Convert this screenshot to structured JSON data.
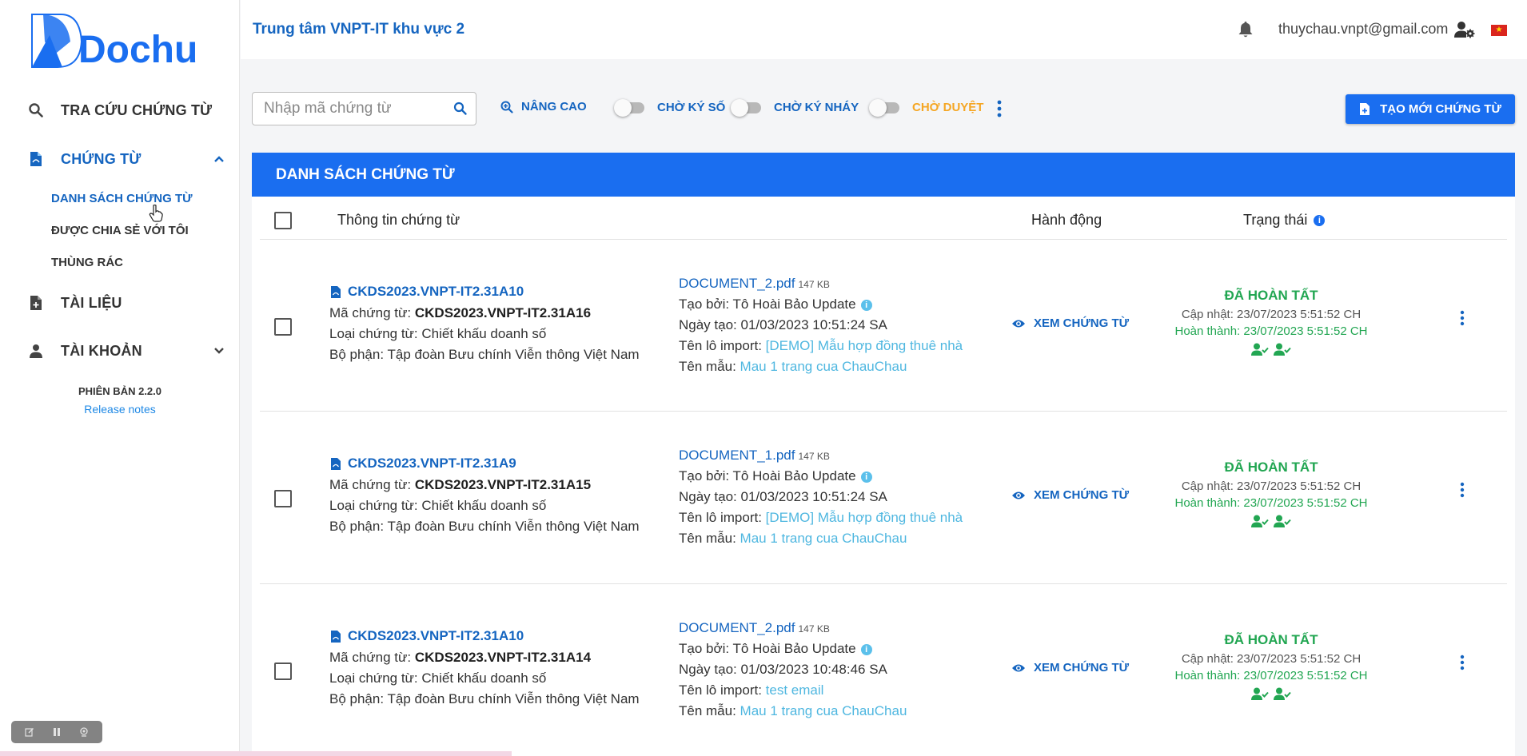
{
  "app": {
    "logo_text": "Dochub",
    "org_title": "Trung tâm VNPT-IT khu vực 2",
    "user_email": "thuychau.vnpt@gmail.com",
    "language_flag": "★"
  },
  "sidebar": {
    "items": [
      {
        "label": "TRA CỨU CHỨNG TỪ",
        "icon": "search-icon"
      },
      {
        "label": "CHỨNG TỪ",
        "icon": "pdf-file-icon"
      },
      {
        "label": "TÀI LIỆU",
        "icon": "file-add-icon"
      },
      {
        "label": "TÀI KHOẢN",
        "icon": "user-icon"
      }
    ],
    "sub_items": [
      "DANH SÁCH CHỨNG TỪ",
      "ĐƯỢC CHIA SẺ VỚI TÔI",
      "THÙNG RÁC"
    ],
    "version": "PHIÊN BẢN 2.2.0",
    "release_notes": "Release notes"
  },
  "toolbar": {
    "search_placeholder": "Nhập mã chứng từ",
    "advanced_label": "NÂNG CAO",
    "toggle_sign": "CHỜ KÝ SỐ",
    "toggle_initial": "CHỜ KÝ NHÁY",
    "toggle_approve": "CHỜ DUYỆT",
    "create_label": "TẠO MỚI CHỨNG TỪ"
  },
  "list": {
    "title": "DANH SÁCH CHỨNG TỪ",
    "columns": {
      "info": "Thông tin chứng từ",
      "action": "Hành động",
      "status": "Trạng thái"
    },
    "labels": {
      "code": "Mã chứng từ:",
      "type": "Loại chứng từ:",
      "dept": "Bộ phận:",
      "created_by": "Tạo bởi:",
      "created_at": "Ngày tạo:",
      "import_batch": "Tên lô import:",
      "template": "Tên mẫu:",
      "view": "XEM CHỨNG TỪ",
      "updated": "Cập nhật:",
      "completed": "Hoàn thành:"
    },
    "rows": [
      {
        "title": "CKDS2023.VNPT-IT2.31A10",
        "code": "CKDS2023.VNPT-IT2.31A16",
        "type": "Chiết khấu doanh số",
        "dept": "Tập đoàn Bưu chính Viễn thông Việt Nam",
        "file": "DOCUMENT_2.pdf",
        "size": "147 KB",
        "created_by": "Tô Hoài Bảo Update",
        "created_at": "01/03/2023 10:51:24 SA",
        "import_batch": "[DEMO] Mẫu hợp đồng thuê nhà",
        "template": "Mau 1 trang cua ChauChau",
        "status": "ĐÃ HOÀN TẤT",
        "updated": "23/07/2023 5:51:52 CH",
        "completed": "23/07/2023 5:51:52 CH"
      },
      {
        "title": "CKDS2023.VNPT-IT2.31A9",
        "code": "CKDS2023.VNPT-IT2.31A15",
        "type": "Chiết khấu doanh số",
        "dept": "Tập đoàn Bưu chính Viễn thông Việt Nam",
        "file": "DOCUMENT_1.pdf",
        "size": "147 KB",
        "created_by": "Tô Hoài Bảo Update",
        "created_at": "01/03/2023 10:51:24 SA",
        "import_batch": "[DEMO] Mẫu hợp đồng thuê nhà",
        "template": "Mau 1 trang cua ChauChau",
        "status": "ĐÃ HOÀN TẤT",
        "updated": "23/07/2023 5:51:52 CH",
        "completed": "23/07/2023 5:51:52 CH"
      },
      {
        "title": "CKDS2023.VNPT-IT2.31A10",
        "code": "CKDS2023.VNPT-IT2.31A14",
        "type": "Chiết khấu doanh số",
        "dept": "Tập đoàn Bưu chính Viễn thông Việt Nam",
        "file": "DOCUMENT_2.pdf",
        "size": "147 KB",
        "created_by": "Tô Hoài Bảo Update",
        "created_at": "01/03/2023 10:48:46 SA",
        "import_batch": "test email",
        "template": "Mau 1 trang cua ChauChau",
        "status": "ĐÃ HOÀN TẤT",
        "updated": "23/07/2023 5:51:52 CH",
        "completed": "23/07/2023 5:51:52 CH"
      }
    ]
  },
  "colors": {
    "primary": "#1a6ef0",
    "link": "#1565c0",
    "success": "#22a652",
    "warning": "#f5a623"
  }
}
